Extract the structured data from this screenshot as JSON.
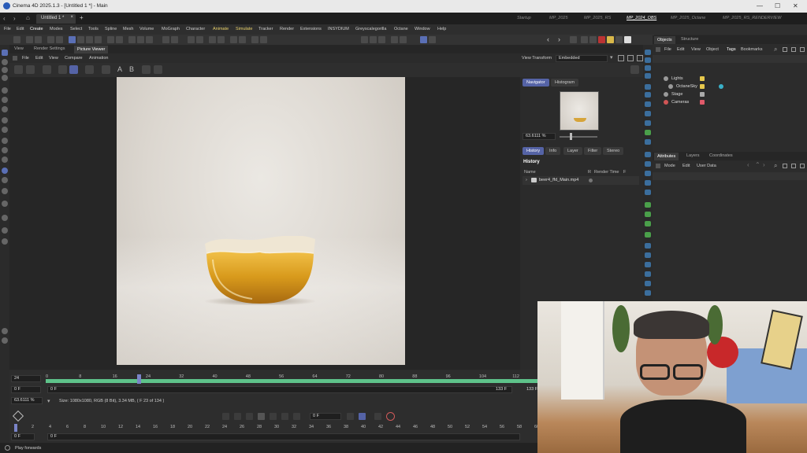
{
  "window": {
    "title": "Cinema 4D 2025.1.3 - [Untitled 1 *] - Main"
  },
  "tabs": {
    "doc": "Untitled 1 *",
    "close": "×",
    "add": "+"
  },
  "layouts": [
    "Startup",
    "MP_2025",
    "MP_2025_RS",
    "MP_2024_OBS",
    "MP_2025_Octane",
    "MP_2025_RS_RENDERVIEW"
  ],
  "active_layout": "MP_2024_OBS",
  "menus": [
    "File",
    "Edit",
    "Create",
    "Modes",
    "Select",
    "Tools",
    "Spline",
    "Mesh",
    "Volume",
    "MoGraph",
    "Character",
    "Animate",
    "Simulate",
    "Tracker",
    "Render",
    "Extensions",
    "INSYDIUM",
    "Greyscalegorilla",
    "Octane",
    "Window",
    "Help"
  ],
  "viewer": {
    "tabs": [
      "View",
      "Render Settings",
      "Picture Viewer"
    ],
    "menu": [
      "File",
      "Edit",
      "View",
      "Compare",
      "Animation"
    ],
    "view_transform_label": "View Transform",
    "view_transform_value": "Embedded"
  },
  "navigator": {
    "tabs": [
      "Navigator",
      "Histogram"
    ],
    "zoom": "63.6111 %",
    "sub_tabs": [
      "History",
      "Info",
      "Layer",
      "Filter",
      "Stereo"
    ],
    "history_title": "History",
    "columns": [
      "Name",
      "R",
      "Render Time",
      "F"
    ],
    "rows": [
      {
        "name": "beer4_ffd_Main.mp4"
      }
    ]
  },
  "objects_panel": {
    "tabs": [
      "Objects",
      "Structure"
    ],
    "menu": [
      "File",
      "Edit",
      "View",
      "Object",
      "Tags",
      "Bookmarks"
    ],
    "items": [
      {
        "label": "Lights",
        "color": "#e7c84c"
      },
      {
        "label": "OctaneSky",
        "color": "#e7c84c"
      },
      {
        "label": "Stage",
        "color": "#aaaaaa"
      },
      {
        "label": "Cameras",
        "color": "#e05a6a"
      }
    ]
  },
  "attributes_panel": {
    "tabs": [
      "Attributes",
      "Layers",
      "Coordinates"
    ],
    "menu": [
      "Mode",
      "Edit",
      "User Data"
    ]
  },
  "timeline": {
    "start_frame": "24",
    "start_field": "0 F",
    "start_field_2": "0 F",
    "end_label": "133 F",
    "end_label_2": "133 F",
    "ticks": [
      "0",
      "8",
      "16",
      "24",
      "32",
      "40",
      "48",
      "56",
      "64",
      "72",
      "80",
      "88",
      "96",
      "104",
      "112"
    ],
    "playhead_frame": 23
  },
  "status": {
    "zoom": "63.6111 %",
    "info": "Size: 1080x1080, RGB (8 Bit), 3.34 MB, ( F 23 of 134 )",
    "hint": "Play forwards"
  },
  "transport": {
    "frame": "0 F"
  },
  "bottom_ruler": {
    "ticks": [
      "0",
      "2",
      "4",
      "6",
      "8",
      "10",
      "12",
      "14",
      "16",
      "18",
      "20",
      "22",
      "24",
      "26",
      "28",
      "30",
      "32",
      "34",
      "36",
      "38",
      "40",
      "42",
      "44",
      "46",
      "48",
      "50",
      "52",
      "54",
      "56",
      "58",
      "60"
    ],
    "start_field": "0 F",
    "end_field": "0 F"
  }
}
